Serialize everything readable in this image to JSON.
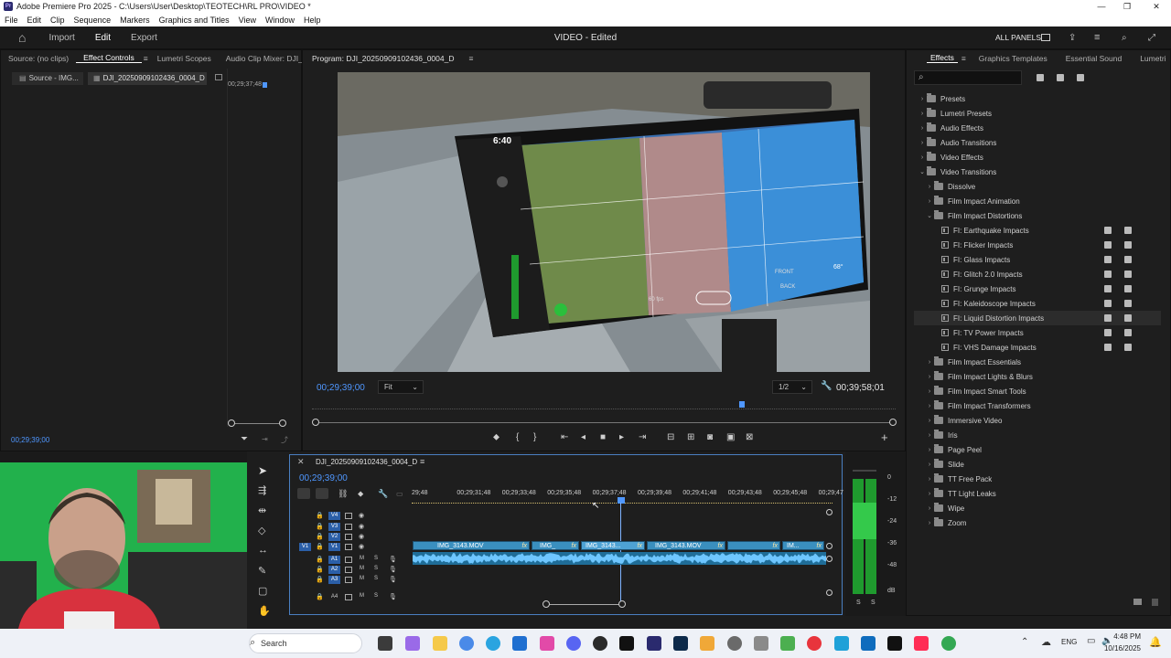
{
  "window": {
    "title": "Adobe Premiere Pro 2025 - C:\\Users\\User\\Desktop\\TEOTECH\\RL PRO\\VIDEO *",
    "logo_text": "Pr",
    "minimize": "—",
    "restore": "❐",
    "close": "✕"
  },
  "menu": [
    "File",
    "Edit",
    "Clip",
    "Sequence",
    "Markers",
    "Graphics and Titles",
    "View",
    "Window",
    "Help"
  ],
  "header": {
    "home": "⌂",
    "tabs": [
      "Import",
      "Edit",
      "Export"
    ],
    "active_tab": "Edit",
    "project_title": "VIDEO",
    "project_status": "- Edited",
    "all_panels": "ALL PANELS"
  },
  "left_panel": {
    "tabs": [
      "Source: (no clips)",
      "Effect Controls",
      "Lumetri Scopes",
      "Audio Clip Mixer: DJI_"
    ],
    "subtabs": [
      "Source - IMG...",
      "DJI_20250909102436_0004_D ..."
    ],
    "mini_time": "00;29;37;48",
    "timecode": "00;29;39;00"
  },
  "program": {
    "title": "Program: DJI_20250909102436_0004_D",
    "timecode_left": "00;29;39;00",
    "zoom": "Fit",
    "resolution": "1/2",
    "timecode_right": "00;39;58;01"
  },
  "video_overlay": {
    "time": "6:40",
    "temp": "68°",
    "fps": "60 fps",
    "front": "FRONT",
    "back": "BACK"
  },
  "effects": {
    "tabs": [
      "Effects",
      "Graphics Templates",
      "Essential Sound",
      "Lumetri"
    ],
    "search_placeholder": "",
    "tree": [
      {
        "label": "Presets",
        "level": 0,
        "type": "folder",
        "expanded": false
      },
      {
        "label": "Lumetri Presets",
        "level": 0,
        "type": "folder",
        "expanded": false
      },
      {
        "label": "Audio Effects",
        "level": 0,
        "type": "folder",
        "expanded": false
      },
      {
        "label": "Audio Transitions",
        "level": 0,
        "type": "folder",
        "expanded": false
      },
      {
        "label": "Video Effects",
        "level": 0,
        "type": "folder",
        "expanded": false
      },
      {
        "label": "Video Transitions",
        "level": 0,
        "type": "folder",
        "expanded": true
      },
      {
        "label": "Dissolve",
        "level": 1,
        "type": "folder",
        "expanded": false
      },
      {
        "label": "Film Impact Animation",
        "level": 1,
        "type": "folder",
        "expanded": false
      },
      {
        "label": "Film Impact Distortions",
        "level": 1,
        "type": "folder",
        "expanded": true
      },
      {
        "label": "FI: Earthquake Impacts",
        "level": 2,
        "type": "effect"
      },
      {
        "label": "FI: Flicker Impacts",
        "level": 2,
        "type": "effect"
      },
      {
        "label": "FI: Glass Impacts",
        "level": 2,
        "type": "effect"
      },
      {
        "label": "FI: Glitch 2.0 Impacts",
        "level": 2,
        "type": "effect"
      },
      {
        "label": "FI: Grunge Impacts",
        "level": 2,
        "type": "effect"
      },
      {
        "label": "FI: Kaleidoscope Impacts",
        "level": 2,
        "type": "effect"
      },
      {
        "label": "FI: Liquid Distortion Impacts",
        "level": 2,
        "type": "effect",
        "highlight": true
      },
      {
        "label": "FI: TV Power Impacts",
        "level": 2,
        "type": "effect"
      },
      {
        "label": "FI: VHS Damage Impacts",
        "level": 2,
        "type": "effect"
      },
      {
        "label": "Film Impact Essentials",
        "level": 1,
        "type": "folder",
        "expanded": false
      },
      {
        "label": "Film Impact Lights & Blurs",
        "level": 1,
        "type": "folder",
        "expanded": false
      },
      {
        "label": "Film Impact Smart Tools",
        "level": 1,
        "type": "folder",
        "expanded": false
      },
      {
        "label": "Film Impact Transformers",
        "level": 1,
        "type": "folder",
        "expanded": false
      },
      {
        "label": "Immersive Video",
        "level": 1,
        "type": "folder",
        "expanded": false
      },
      {
        "label": "Iris",
        "level": 1,
        "type": "folder",
        "expanded": false
      },
      {
        "label": "Page Peel",
        "level": 1,
        "type": "folder",
        "expanded": false
      },
      {
        "label": "Slide",
        "level": 1,
        "type": "folder",
        "expanded": false
      },
      {
        "label": "TT Free Pack",
        "level": 1,
        "type": "folder",
        "expanded": false
      },
      {
        "label": "TT Light Leaks",
        "level": 1,
        "type": "folder",
        "expanded": false
      },
      {
        "label": "Wipe",
        "level": 1,
        "type": "folder",
        "expanded": false
      },
      {
        "label": "Zoom",
        "level": 1,
        "type": "folder",
        "expanded": false
      }
    ]
  },
  "timeline": {
    "sequence": "DJI_20250909102436_0004_D",
    "timecode": "00;29;39;00",
    "ruler": [
      "29;48",
      "00;29;31;48",
      "00;29;33;48",
      "00;29;35;48",
      "00;29;37;48",
      "00;29;39;48",
      "00;29;41;48",
      "00;29;43;48",
      "00;29;45;48",
      "00;29;47"
    ],
    "video_tracks": [
      "V4",
      "V3",
      "V2",
      "V1"
    ],
    "audio_tracks": [
      "A1",
      "A2",
      "A3",
      "A4"
    ],
    "clips": [
      "IMG_3143.MOV",
      "IMG_",
      "IMG_3143...",
      "IMG_3143.MOV",
      "IM..."
    ],
    "fx_label": "fx",
    "meter_scale": [
      "0",
      "-12",
      "-24",
      "-36",
      "-48",
      "dB"
    ],
    "meter_solo": [
      "S",
      "S"
    ]
  },
  "taskbar": {
    "search": "Search",
    "lang": "ENG",
    "time": "4:48 PM",
    "date": "10/16/2025"
  }
}
